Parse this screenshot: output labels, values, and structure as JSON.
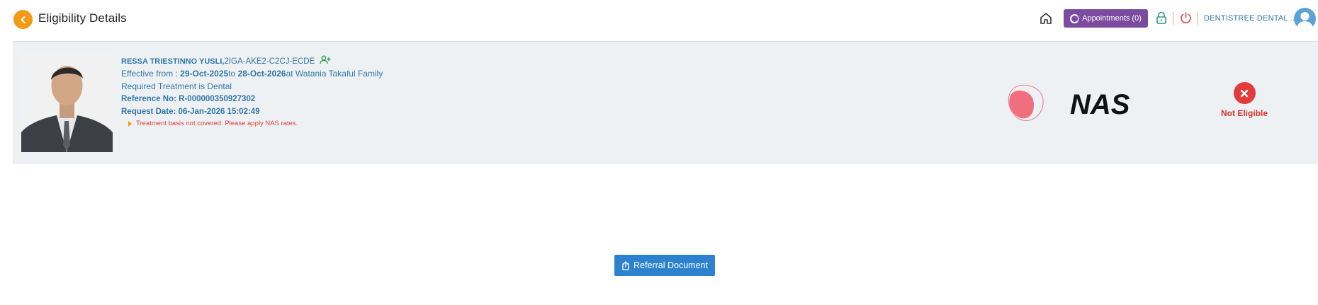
{
  "header": {
    "title": "Eligibility Details",
    "appointments_label": "Appointments (0)",
    "clinic_name": "DENTISTREE DENTAL ..."
  },
  "patient": {
    "name": "RESSA TRIESTINNO YUSLI,",
    "member_code": "2IGA-AKE2-C2CJ-ECDE",
    "effective_prefix": "Effective from : ",
    "effective_from": "29-Oct-2025",
    "effective_to_word": "to ",
    "effective_to": "28-Oct-2026",
    "effective_at": "at Watania Takaful Family",
    "required_treatment": "Required Treatment is Dental",
    "reference": "Reference No: R-000000350927302",
    "request_date": "Request Date: 06-Jan-2026 15:02:49",
    "note": "Treatment basis not covered. Please apply NAS rates."
  },
  "insurer": {
    "logo_text": "NAS"
  },
  "eligibility": {
    "status": "Not Eligible"
  },
  "actions": {
    "referral_label": "Referral Document"
  },
  "colors": {
    "accent_orange": "#f39a14",
    "appointments_purple": "#7a4b9e",
    "link_blue": "#2f78a6",
    "error_red": "#e23b3b",
    "primary_button": "#2d82cf"
  }
}
